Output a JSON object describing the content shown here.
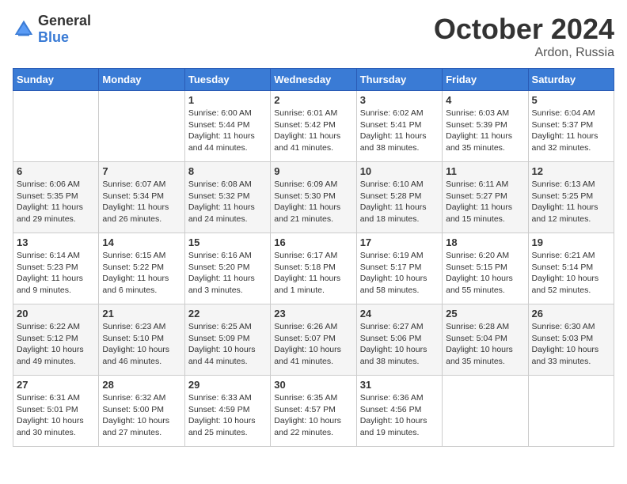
{
  "header": {
    "logo_general": "General",
    "logo_blue": "Blue",
    "month": "October 2024",
    "location": "Ardon, Russia"
  },
  "weekdays": [
    "Sunday",
    "Monday",
    "Tuesday",
    "Wednesday",
    "Thursday",
    "Friday",
    "Saturday"
  ],
  "weeks": [
    [
      {
        "day": "",
        "info": ""
      },
      {
        "day": "",
        "info": ""
      },
      {
        "day": "1",
        "info": "Sunrise: 6:00 AM\nSunset: 5:44 PM\nDaylight: 11 hours and 44 minutes."
      },
      {
        "day": "2",
        "info": "Sunrise: 6:01 AM\nSunset: 5:42 PM\nDaylight: 11 hours and 41 minutes."
      },
      {
        "day": "3",
        "info": "Sunrise: 6:02 AM\nSunset: 5:41 PM\nDaylight: 11 hours and 38 minutes."
      },
      {
        "day": "4",
        "info": "Sunrise: 6:03 AM\nSunset: 5:39 PM\nDaylight: 11 hours and 35 minutes."
      },
      {
        "day": "5",
        "info": "Sunrise: 6:04 AM\nSunset: 5:37 PM\nDaylight: 11 hours and 32 minutes."
      }
    ],
    [
      {
        "day": "6",
        "info": "Sunrise: 6:06 AM\nSunset: 5:35 PM\nDaylight: 11 hours and 29 minutes."
      },
      {
        "day": "7",
        "info": "Sunrise: 6:07 AM\nSunset: 5:34 PM\nDaylight: 11 hours and 26 minutes."
      },
      {
        "day": "8",
        "info": "Sunrise: 6:08 AM\nSunset: 5:32 PM\nDaylight: 11 hours and 24 minutes."
      },
      {
        "day": "9",
        "info": "Sunrise: 6:09 AM\nSunset: 5:30 PM\nDaylight: 11 hours and 21 minutes."
      },
      {
        "day": "10",
        "info": "Sunrise: 6:10 AM\nSunset: 5:28 PM\nDaylight: 11 hours and 18 minutes."
      },
      {
        "day": "11",
        "info": "Sunrise: 6:11 AM\nSunset: 5:27 PM\nDaylight: 11 hours and 15 minutes."
      },
      {
        "day": "12",
        "info": "Sunrise: 6:13 AM\nSunset: 5:25 PM\nDaylight: 11 hours and 12 minutes."
      }
    ],
    [
      {
        "day": "13",
        "info": "Sunrise: 6:14 AM\nSunset: 5:23 PM\nDaylight: 11 hours and 9 minutes."
      },
      {
        "day": "14",
        "info": "Sunrise: 6:15 AM\nSunset: 5:22 PM\nDaylight: 11 hours and 6 minutes."
      },
      {
        "day": "15",
        "info": "Sunrise: 6:16 AM\nSunset: 5:20 PM\nDaylight: 11 hours and 3 minutes."
      },
      {
        "day": "16",
        "info": "Sunrise: 6:17 AM\nSunset: 5:18 PM\nDaylight: 11 hours and 1 minute."
      },
      {
        "day": "17",
        "info": "Sunrise: 6:19 AM\nSunset: 5:17 PM\nDaylight: 10 hours and 58 minutes."
      },
      {
        "day": "18",
        "info": "Sunrise: 6:20 AM\nSunset: 5:15 PM\nDaylight: 10 hours and 55 minutes."
      },
      {
        "day": "19",
        "info": "Sunrise: 6:21 AM\nSunset: 5:14 PM\nDaylight: 10 hours and 52 minutes."
      }
    ],
    [
      {
        "day": "20",
        "info": "Sunrise: 6:22 AM\nSunset: 5:12 PM\nDaylight: 10 hours and 49 minutes."
      },
      {
        "day": "21",
        "info": "Sunrise: 6:23 AM\nSunset: 5:10 PM\nDaylight: 10 hours and 46 minutes."
      },
      {
        "day": "22",
        "info": "Sunrise: 6:25 AM\nSunset: 5:09 PM\nDaylight: 10 hours and 44 minutes."
      },
      {
        "day": "23",
        "info": "Sunrise: 6:26 AM\nSunset: 5:07 PM\nDaylight: 10 hours and 41 minutes."
      },
      {
        "day": "24",
        "info": "Sunrise: 6:27 AM\nSunset: 5:06 PM\nDaylight: 10 hours and 38 minutes."
      },
      {
        "day": "25",
        "info": "Sunrise: 6:28 AM\nSunset: 5:04 PM\nDaylight: 10 hours and 35 minutes."
      },
      {
        "day": "26",
        "info": "Sunrise: 6:30 AM\nSunset: 5:03 PM\nDaylight: 10 hours and 33 minutes."
      }
    ],
    [
      {
        "day": "27",
        "info": "Sunrise: 6:31 AM\nSunset: 5:01 PM\nDaylight: 10 hours and 30 minutes."
      },
      {
        "day": "28",
        "info": "Sunrise: 6:32 AM\nSunset: 5:00 PM\nDaylight: 10 hours and 27 minutes."
      },
      {
        "day": "29",
        "info": "Sunrise: 6:33 AM\nSunset: 4:59 PM\nDaylight: 10 hours and 25 minutes."
      },
      {
        "day": "30",
        "info": "Sunrise: 6:35 AM\nSunset: 4:57 PM\nDaylight: 10 hours and 22 minutes."
      },
      {
        "day": "31",
        "info": "Sunrise: 6:36 AM\nSunset: 4:56 PM\nDaylight: 10 hours and 19 minutes."
      },
      {
        "day": "",
        "info": ""
      },
      {
        "day": "",
        "info": ""
      }
    ]
  ]
}
